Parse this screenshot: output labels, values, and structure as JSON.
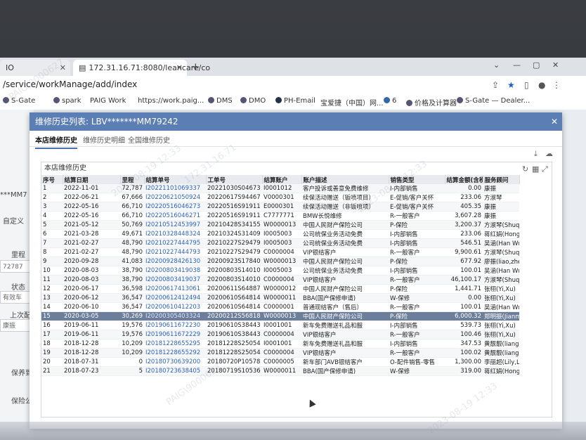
{
  "browser": {
    "tabs": [
      {
        "label": "IO"
      },
      {
        "label": "172.31.16.71:8080/leancare/co"
      }
    ],
    "url": "/service/workManage/add/index",
    "bookmarks": [
      "S-Gate",
      "spark",
      "PAIG Work",
      "https://work.paig...",
      "DMS",
      "DMO",
      "PH-Email",
      "宝爱捷（中国）网...",
      "6",
      "价格及计算器",
      "S-Gate — Dealer..."
    ]
  },
  "left_panel": {
    "labels": [
      "***MM7",
      "自定义",
      "里程",
      "72787",
      "状态",
      "有效车",
      "上次配",
      "康振",
      "保养到",
      "保险公"
    ]
  },
  "modal": {
    "title": "维修历史列表: LBV*******MM79242",
    "tabs": [
      "本店维修历史",
      "维修历史明细",
      "全国维修历史"
    ],
    "panel_title": "本店维修历史",
    "columns": [
      "序号",
      "结算日期",
      "里程",
      "结算单号",
      "工单号",
      "结算账户",
      "账户描述",
      "销售类型",
      "结算金额(含税)",
      "服务顾问"
    ],
    "rows": [
      [
        "1",
        "2022-11-01",
        "72,787",
        "I20221101069337",
        "20221030S04673",
        "I0001012",
        "客户投诉或善意免费维修",
        "I-内部销售",
        "0.00",
        "康振"
      ],
      [
        "2",
        "2022-06-21",
        "67,666",
        "I20220621050924",
        "20220617S94467",
        "V0000301",
        "续保活动赠送（钣喷项目）",
        "E-促销/客户关怀",
        "233.06",
        "方淑琴"
      ],
      [
        "3",
        "2022-05-16",
        "66,710",
        "I20220516046273",
        "20220516S91911",
        "E0000301",
        "续保活动赠送（非钣喷项）",
        "E-促销/客户关怀",
        "405.35",
        "康振"
      ],
      [
        "4",
        "2022-05-16",
        "66,710",
        "I20220516046271",
        "20220516S91911",
        "C7777771",
        "BMW长悦维修",
        "R-一般客户",
        "3,607.28",
        "康振"
      ],
      [
        "5",
        "2021-05-12",
        "50,769",
        "I20210512453997",
        "20210428S34155",
        "W0000013",
        "中国人民财产保险公司",
        "P-保险",
        "3,200.37",
        "方淑琴(Shuqing,fang)"
      ],
      [
        "6",
        "2021-03-28",
        "49,671",
        "I20210328448324",
        "20210324S31409",
        "I0005003",
        "公司统保业务活动免费",
        "I-内部销售",
        "233.06",
        "蒋红娟(Hongjuan,Jiang)"
      ],
      [
        "7",
        "2021-02-27",
        "48,790",
        "I20210227444795",
        "20210227S29479",
        "I0005003",
        "公司统保业务活动免费",
        "I-内部销售",
        "546.51",
        "吴涵(Han Wu)"
      ],
      [
        "8",
        "2021-02-27",
        "48,790",
        "I20210227444793",
        "20210227S29479",
        "C0000004",
        "VIP银结客户",
        "R-一般客户",
        "9,900.61",
        "方淑琴(Shuqing,fang)"
      ],
      [
        "9",
        "2020-09-28",
        "41,083",
        "I20200928426130",
        "20200923S17840",
        "W0000013",
        "中国人民财产保险公司",
        "P-保险",
        "677.92",
        "廖振(liao,zhen)"
      ],
      [
        "10",
        "2020-08-03",
        "38,790",
        "I20200803419038",
        "20200803S14010",
        "I0005003",
        "公司统保业务活动免费",
        "I-内部销售",
        "100.01",
        "吴涵(Han Wu)"
      ],
      [
        "11",
        "2020-08-03",
        "38,790",
        "I20200803419037",
        "20200803S14010",
        "C0000004",
        "VIP银结客户",
        "R-一般客户",
        "46,100.17",
        "方淑琴(Shuqing,fang)"
      ],
      [
        "12",
        "2020-06-17",
        "36,598",
        "I20200617413061",
        "20200611S64887",
        "W0000012",
        "中国人民财产保险公司",
        "P-保险",
        "1,441.71",
        "张栩(Yi,Xu)"
      ],
      [
        "13",
        "2020-06-12",
        "36,547",
        "I20200612412494",
        "20200610S64814",
        "W0000011",
        "BBA(国产保修申请)",
        "W-保修",
        "0.00",
        "张栩(Yi,Xu)"
      ],
      [
        "14",
        "2020-06-10",
        "36,547",
        "I20200610412203",
        "20200610S64814",
        "C0000001",
        "普通现结客户（售后）",
        "R-一般客户",
        "100.01",
        "吴涵(Han Wu)"
      ],
      [
        "15",
        "2020-03-05",
        "30,269",
        "I20200305403324",
        "20200212S56818",
        "W0000013",
        "中国人民财产保险公司",
        "P-保险",
        "6,000.32",
        "郑明振(Jianming,Zhen)"
      ],
      [
        "16",
        "2019-06-11",
        "19,576",
        "I20190611672230",
        "20190610S38443",
        "I0001001",
        "新车免费赠送礼品和服",
        "I-内部销售",
        "539.73",
        "张栩(Yi,Xu)"
      ],
      [
        "17",
        "2019-06-11",
        "19,576",
        "I20190611672229",
        "20190610S38443",
        "C0000004",
        "VIP银结客户",
        "R-一般客户",
        "100.46",
        "张栩(Yi,Xu)"
      ],
      [
        "18",
        "2018-12-28",
        "10,209",
        "I20181228655295",
        "20181228S25054",
        "I0001001",
        "新车免费赠送礼品和服",
        "I-内部销售",
        "347.53",
        "黄靓靓(liangliang huang)"
      ],
      [
        "19",
        "2018-12-28",
        "10,209",
        "I20181228655292",
        "20181228S25054",
        "C0000004",
        "VIP银结客户",
        "R-一般客户",
        "100.02",
        "黄靓靓(liangliang huang)"
      ],
      [
        "20",
        "2018-07-31",
        "0",
        "I20180730639200",
        "20180720P10578",
        "C0000005",
        "新车部门AVB银结客户",
        "O-配件销售-零售",
        "1,300.00",
        "李丽超(Lily,Li)"
      ],
      [
        "21",
        "2018-07-23",
        "5",
        "I20180723638405",
        "20180719S10536",
        "W0000011",
        "BBA(国产保修申请)",
        "W-保修",
        "319.00",
        "蒋红娟(Hongjuan,Jiang)"
      ]
    ],
    "selected_row": 15
  },
  "watermarks": [
    "PAIG\\9000627",
    "2023-08-19 12:33",
    "172.31.16.71"
  ]
}
